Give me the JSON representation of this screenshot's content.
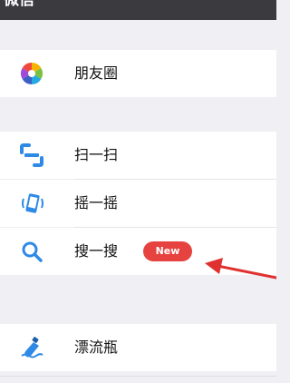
{
  "header": {
    "title": "微信"
  },
  "items": [
    {
      "label": "朋友圈",
      "icon": "moments-icon"
    },
    {
      "label": "扫一扫",
      "icon": "scan-icon"
    },
    {
      "label": "摇一摇",
      "icon": "shake-icon"
    },
    {
      "label": "搜一搜",
      "icon": "search-icon",
      "badge": "New"
    },
    {
      "label": "漂流瓶",
      "icon": "drift-bottle-icon"
    }
  ],
  "colors": {
    "header_bg": "#3a3a3f",
    "page_bg": "#efeff4",
    "badge": "#e64340",
    "arrow": "#e03131",
    "scan": "#2e8ae6",
    "search": "#2e8ae6"
  }
}
